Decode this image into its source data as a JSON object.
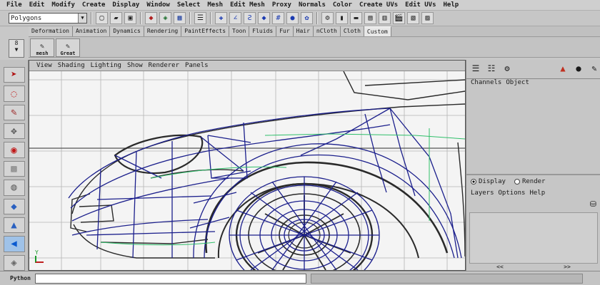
{
  "menubar": {
    "items": [
      "File",
      "Edit",
      "Modify",
      "Create",
      "Display",
      "Window",
      "Select",
      "Mesh",
      "Edit Mesh",
      "Proxy",
      "Normals",
      "Color",
      "Create UVs",
      "Edit UVs",
      "Help"
    ]
  },
  "statusline": {
    "mode": "Polygons",
    "icons": [
      "new-scene-icon",
      "open-scene-icon",
      "save-scene-icon",
      "select-hierarchy-icon",
      "select-object-icon",
      "select-component-icon",
      "input-line-icon",
      "snap-grid-icon",
      "snap-curve-icon",
      "snap-point-icon",
      "snap-plane-icon",
      "render-icon",
      "ipr-icon",
      "render-settings-icon"
    ]
  },
  "shelf": {
    "tabs": [
      "Deformation",
      "Animation",
      "Dynamics",
      "Rendering",
      "PaintEffects",
      "Toon",
      "Fluids",
      "Fur",
      "Hair",
      "nCloth",
      "Cloth",
      "Custom"
    ],
    "active_tab": "Custom",
    "buttons": [
      {
        "label": "mesh",
        "icon": "mel-script-icon"
      },
      {
        "label": "Great",
        "icon": "mel-script-icon"
      }
    ],
    "menu_label": "8"
  },
  "viewport": {
    "menu": [
      "View",
      "Shading",
      "Lighting",
      "Show",
      "Renderer",
      "Panels"
    ],
    "axis_label": "Y"
  },
  "channelbox": {
    "menu": [
      "Channels",
      "Object"
    ]
  },
  "layereditor": {
    "radio_display": "Display",
    "radio_render": "Render",
    "menu": [
      "Layers",
      "Options",
      "Help"
    ],
    "scroll_left": "<<",
    "scroll_right": ">>"
  },
  "commandline": {
    "label": "Python"
  },
  "colors": {
    "wire": "#1b1f8c",
    "guide": "#2fbf6a",
    "grid": "#9a9a9a",
    "toolbox_active": "#9fc2e8"
  }
}
